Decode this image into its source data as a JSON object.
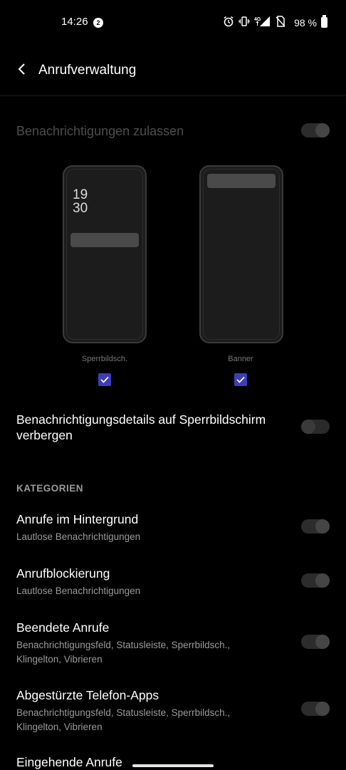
{
  "status_bar": {
    "time": "14:26",
    "notification_count": "2",
    "network": "4G",
    "battery_percent": "98 %"
  },
  "app_bar": {
    "title": "Anrufverwaltung"
  },
  "allow_notifications": {
    "label": "Benachrichtigungen zulassen",
    "enabled": true
  },
  "previews": [
    {
      "label": "Sperrbildsch.",
      "checked": true,
      "clock_hour": "19",
      "clock_minute": "30"
    },
    {
      "label": "Banner",
      "checked": true
    }
  ],
  "hide_details": {
    "label": "Benachrichtigungsdetails auf Sperrbildschirm verbergen",
    "enabled": false
  },
  "categories": {
    "header": "KATEGORIEN",
    "items": [
      {
        "title": "Anrufe im Hintergrund",
        "subtitle": "Lautlose Benachrichtigungen",
        "enabled": true
      },
      {
        "title": "Anrufblockierung",
        "subtitle": "Lautlose Benachrichtigungen",
        "enabled": true
      },
      {
        "title": "Beendete Anrufe",
        "subtitle": "Benachrichtigungsfeld, Statusleiste, Sperrbildsch., Klingelton, Vibrieren",
        "enabled": true
      },
      {
        "title": "Abgestürzte Telefon-Apps",
        "subtitle": "Benachrichtigungsfeld, Statusleiste, Sperrbildsch., Klingelton, Vibrieren",
        "enabled": true
      },
      {
        "title": "Eingehende Anrufe"
      }
    ]
  },
  "colors": {
    "background": "#000000",
    "checkbox": "#3d3dba",
    "disabled_text": "#4d4d4d",
    "secondary_text": "#9a9a9a"
  }
}
